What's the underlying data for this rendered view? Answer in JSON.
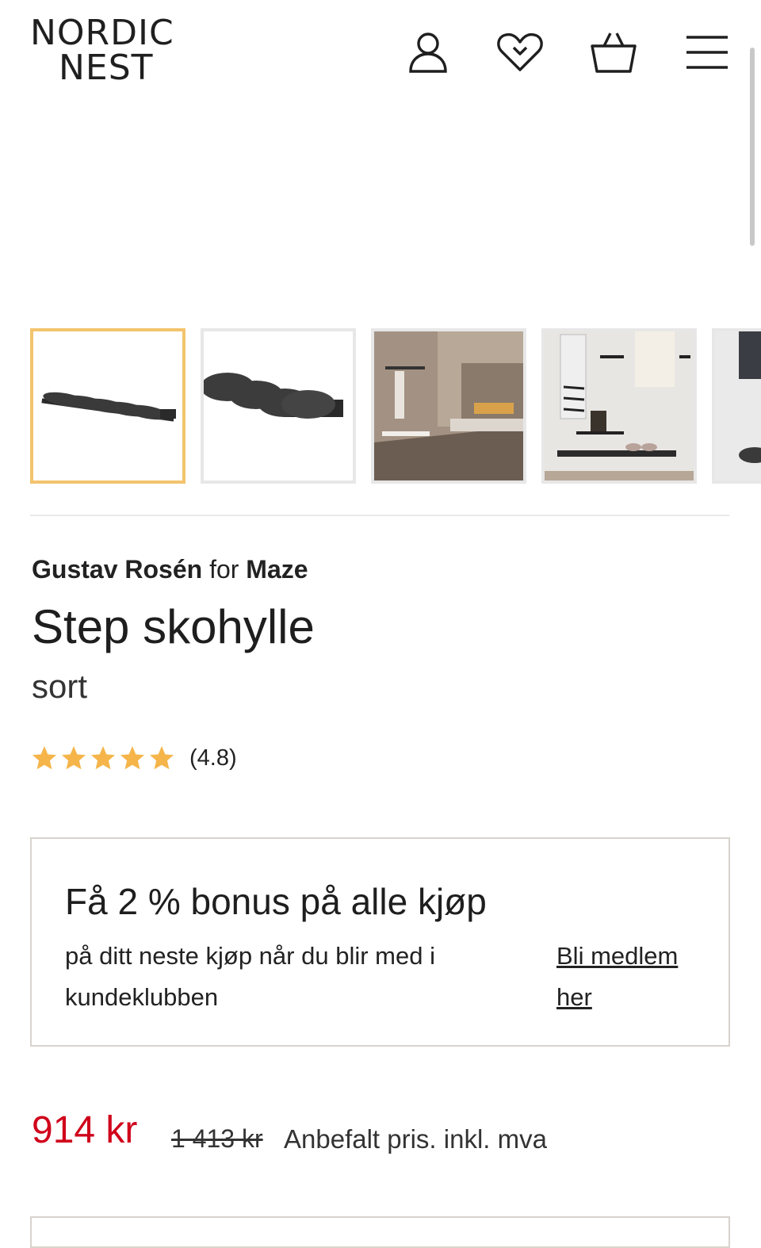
{
  "header": {
    "logo_line1": "NORDIC",
    "logo_line2": "NEST",
    "icons": [
      "user-icon",
      "heart-icon",
      "basket-icon",
      "menu-icon"
    ]
  },
  "gallery": {
    "thumbnails": [
      "shoe-shelf-front",
      "shoe-shelf-angle",
      "hallway-interior",
      "wall-hooks-interior",
      "partial-image"
    ],
    "active_index": 0
  },
  "product": {
    "designer": "Gustav Rosén",
    "for_text": "for",
    "brand": "Maze",
    "name": "Step skohylle",
    "variant": "sort",
    "rating_text": "(4.8)",
    "rating_value": 4.8,
    "rating_max": 5
  },
  "bonus": {
    "heading": "Få 2 % bonus på alle kjøp",
    "text": "på ditt neste kjøp når du blir med i kundeklubben",
    "link": "Bli medlem her"
  },
  "price": {
    "current": "914 kr",
    "original": "1 413 kr",
    "note": "Anbefalt pris. inkl. mva"
  },
  "colors": {
    "price_red": "#d0021b",
    "star_orange": "#f5b54a",
    "active_border": "#f3c46d"
  }
}
